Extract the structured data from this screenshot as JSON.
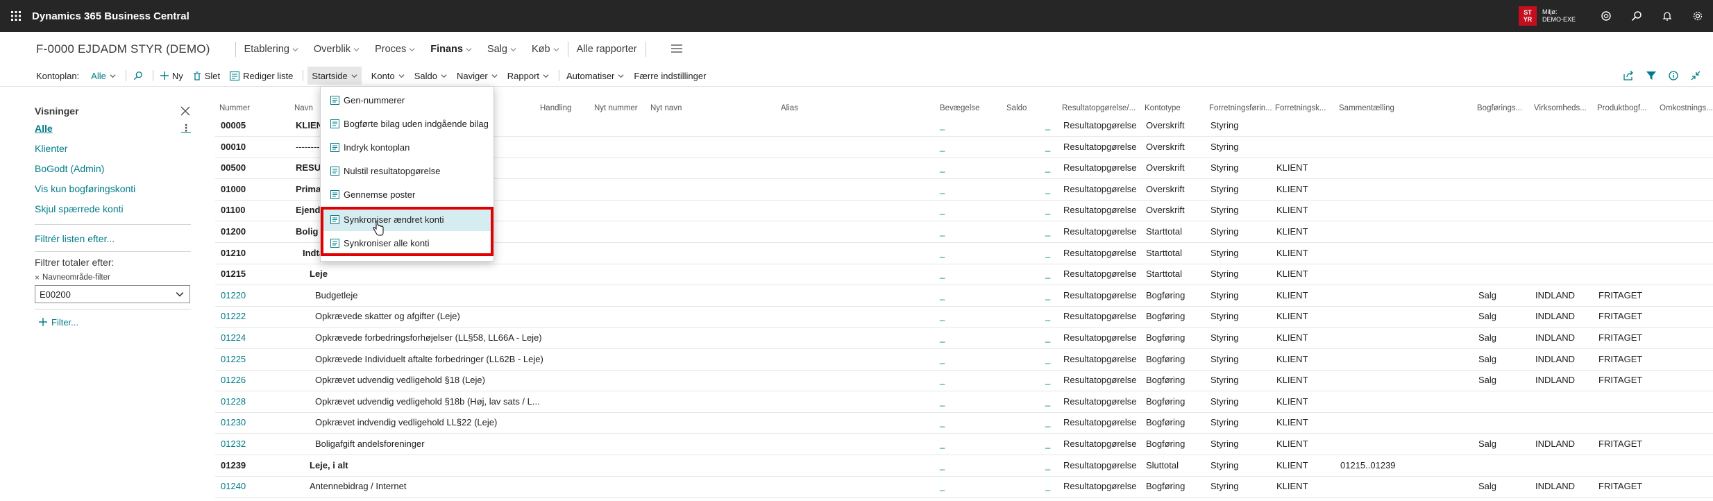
{
  "topbar": {
    "title": "Dynamics 365 Business Central",
    "env_badge_line1": "ST",
    "env_badge_line2": "YR",
    "env_label": "Miljø:",
    "env_value": "DEMO-EXE"
  },
  "page": {
    "title": "F-0000 EJDADM STYR (DEMO)",
    "nav": [
      {
        "label": "Etablering"
      },
      {
        "label": "Overblik"
      },
      {
        "label": "Proces"
      },
      {
        "label": "Finans"
      },
      {
        "label": "Salg"
      },
      {
        "label": "Køb"
      }
    ],
    "all_reports": "Alle rapporter"
  },
  "actionbar": {
    "kontoplan_label": "Kontoplan:",
    "kontoplan_value": "Alle",
    "new": "Ny",
    "delete": "Slet",
    "edit_list": "Rediger liste",
    "startside": "Startside",
    "konto": "Konto",
    "saldo": "Saldo",
    "naviger": "Naviger",
    "rapport": "Rapport",
    "automatiser": "Automatiser",
    "fewer": "Færre indstillinger"
  },
  "leftpanel": {
    "title": "Visninger",
    "views": [
      "Alle",
      "Klienter",
      "BoGodt (Admin)",
      "Vis kun bogføringskonti",
      "Skjul spærrede konti"
    ],
    "filter_list": "Filtrér listen efter...",
    "filter_totals": "Filtrer totaler efter:",
    "chip": "Navneområde-filter",
    "select_value": "E00200",
    "add_filter": "Filter..."
  },
  "grid": {
    "headers": [
      "Nummer",
      "Navn",
      "Handling",
      "Nyt nummer",
      "Nyt navn",
      "Alias",
      "Bevægelse",
      "Saldo",
      "Resultatopgørelse/...",
      "Kontotype",
      "Forretningsførin...",
      "Forretningsk...",
      "Sammentælling",
      "Bogførings...",
      "Virksomheds...",
      "Produktbogf...",
      "Omkostnings..."
    ],
    "rows": [
      {
        "num": "00005",
        "name": "KLIENT",
        "bold": true,
        "link": false,
        "ind": 0,
        "rs": "Resultatopgørelse",
        "kt": "Overskrift",
        "ff": "Styring",
        "fk": "",
        "sum": "",
        "bog": "",
        "virk": "",
        "prod": ""
      },
      {
        "num": "00010",
        "name": "--------",
        "bold": false,
        "link": false,
        "ind": 0,
        "rs": "Resultatopgørelse",
        "kt": "Overskrift",
        "ff": "Styring",
        "fk": "",
        "sum": "",
        "bog": "",
        "virk": "",
        "prod": ""
      },
      {
        "num": "00500",
        "name": "RESUL",
        "bold": true,
        "link": false,
        "ind": 0,
        "rs": "Resultatopgørelse",
        "kt": "Overskrift",
        "ff": "Styring",
        "fk": "KLIENT",
        "sum": "",
        "bog": "",
        "virk": "",
        "prod": ""
      },
      {
        "num": "01000",
        "name": "Primæ",
        "bold": true,
        "link": false,
        "ind": 0,
        "rs": "Resultatopgørelse",
        "kt": "Overskrift",
        "ff": "Styring",
        "fk": "KLIENT",
        "sum": "",
        "bog": "",
        "virk": "",
        "prod": ""
      },
      {
        "num": "01100",
        "name": "Ejend",
        "bold": true,
        "link": false,
        "ind": 0,
        "rs": "Resultatopgørelse",
        "kt": "Overskrift",
        "ff": "Styring",
        "fk": "KLIENT",
        "sum": "",
        "bog": "",
        "virk": "",
        "prod": ""
      },
      {
        "num": "01200",
        "name": "Bolig",
        "bold": true,
        "link": false,
        "ind": 0,
        "rs": "Resultatopgørelse",
        "kt": "Starttotal",
        "ff": "Styring",
        "fk": "KLIENT",
        "sum": "",
        "bog": "",
        "virk": "",
        "prod": ""
      },
      {
        "num": "01210",
        "name": "Indtægter",
        "bold": true,
        "link": false,
        "ind": 10,
        "rs": "Resultatopgørelse",
        "kt": "Starttotal",
        "ff": "Styring",
        "fk": "KLIENT",
        "sum": "",
        "bog": "",
        "virk": "",
        "prod": ""
      },
      {
        "num": "01215",
        "name": "Leje",
        "bold": true,
        "link": false,
        "ind": 20,
        "rs": "Resultatopgørelse",
        "kt": "Starttotal",
        "ff": "Styring",
        "fk": "KLIENT",
        "sum": "",
        "bog": "",
        "virk": "",
        "prod": ""
      },
      {
        "num": "01220",
        "name": "Budgetleje",
        "bold": false,
        "link": true,
        "ind": 28,
        "rs": "Resultatopgørelse",
        "kt": "Bogføring",
        "ff": "Styring",
        "fk": "KLIENT",
        "sum": "",
        "bog": "Salg",
        "virk": "INDLAND",
        "prod": "FRITAGET"
      },
      {
        "num": "01222",
        "name": "Opkrævede skatter og afgifter (Leje)",
        "bold": false,
        "link": true,
        "ind": 28,
        "rs": "Resultatopgørelse",
        "kt": "Bogføring",
        "ff": "Styring",
        "fk": "KLIENT",
        "sum": "",
        "bog": "Salg",
        "virk": "INDLAND",
        "prod": "FRITAGET"
      },
      {
        "num": "01224",
        "name": "Opkrævede forbedringsforhøjelser (LL§58, LL66A - Leje)",
        "bold": false,
        "link": true,
        "ind": 28,
        "rs": "Resultatopgørelse",
        "kt": "Bogføring",
        "ff": "Styring",
        "fk": "KLIENT",
        "sum": "",
        "bog": "Salg",
        "virk": "INDLAND",
        "prod": "FRITAGET"
      },
      {
        "num": "01225",
        "name": "Opkrævede Individuelt aftalte forbedringer (LL62B - Leje)",
        "bold": false,
        "link": true,
        "ind": 28,
        "rs": "Resultatopgørelse",
        "kt": "Bogføring",
        "ff": "Styring",
        "fk": "KLIENT",
        "sum": "",
        "bog": "Salg",
        "virk": "INDLAND",
        "prod": "FRITAGET"
      },
      {
        "num": "01226",
        "name": "Opkrævet udvendig vedligehold §18 (Leje)",
        "bold": false,
        "link": true,
        "ind": 28,
        "rs": "Resultatopgørelse",
        "kt": "Bogføring",
        "ff": "Styring",
        "fk": "KLIENT",
        "sum": "",
        "bog": "Salg",
        "virk": "INDLAND",
        "prod": "FRITAGET"
      },
      {
        "num": "01228",
        "name": "Opkrævet udvendig vedligehold §18b (Høj, lav sats / L...",
        "bold": false,
        "link": true,
        "ind": 28,
        "rs": "Resultatopgørelse",
        "kt": "Bogføring",
        "ff": "Styring",
        "fk": "KLIENT",
        "sum": "",
        "bog": "",
        "virk": "",
        "prod": ""
      },
      {
        "num": "01230",
        "name": "Opkrævet indvendig vedligehold LL§22 (Leje)",
        "bold": false,
        "link": true,
        "ind": 28,
        "rs": "Resultatopgørelse",
        "kt": "Bogføring",
        "ff": "Styring",
        "fk": "KLIENT",
        "sum": "",
        "bog": "",
        "virk": "",
        "prod": ""
      },
      {
        "num": "01232",
        "name": "Boligafgift andelsforeninger",
        "bold": false,
        "link": true,
        "ind": 28,
        "rs": "Resultatopgørelse",
        "kt": "Bogføring",
        "ff": "Styring",
        "fk": "KLIENT",
        "sum": "",
        "bog": "Salg",
        "virk": "INDLAND",
        "prod": "FRITAGET"
      },
      {
        "num": "01239",
        "name": "Leje, i alt",
        "bold": true,
        "link": false,
        "ind": 20,
        "rs": "Resultatopgørelse",
        "kt": "Sluttotal",
        "ff": "Styring",
        "fk": "KLIENT",
        "sum": "01215..01239",
        "bog": "",
        "virk": "",
        "prod": ""
      },
      {
        "num": "01240",
        "name": "Antennebidrag / Internet",
        "bold": false,
        "link": true,
        "ind": 20,
        "rs": "Resultatopgørelse",
        "kt": "Bogføring",
        "ff": "Styring",
        "fk": "KLIENT",
        "sum": "",
        "bog": "Salg",
        "virk": "INDLAND",
        "prod": "FRITAGET"
      }
    ],
    "dash": "_"
  },
  "dropdown": {
    "items": [
      {
        "label": "Gen-nummerer",
        "icon": "renumber-icon"
      },
      {
        "label": "Bogførte bilag uden indgående bilag",
        "icon": "document-icon"
      },
      {
        "label": "Indryk kontoplan",
        "icon": "indent-icon"
      },
      {
        "label": "Nulstil resultatopgørelse",
        "icon": "reset-icon"
      },
      {
        "label": "Gennemse poster",
        "icon": "document-icon"
      },
      {
        "label": "Synkroniser ændret konti",
        "icon": "sync-icon"
      },
      {
        "label": "Synkroniser alle konti",
        "icon": "sync-icon"
      }
    ]
  },
  "colors": {
    "accent": "#007c89",
    "topbar": "#262626",
    "highlight": "#e00000"
  }
}
